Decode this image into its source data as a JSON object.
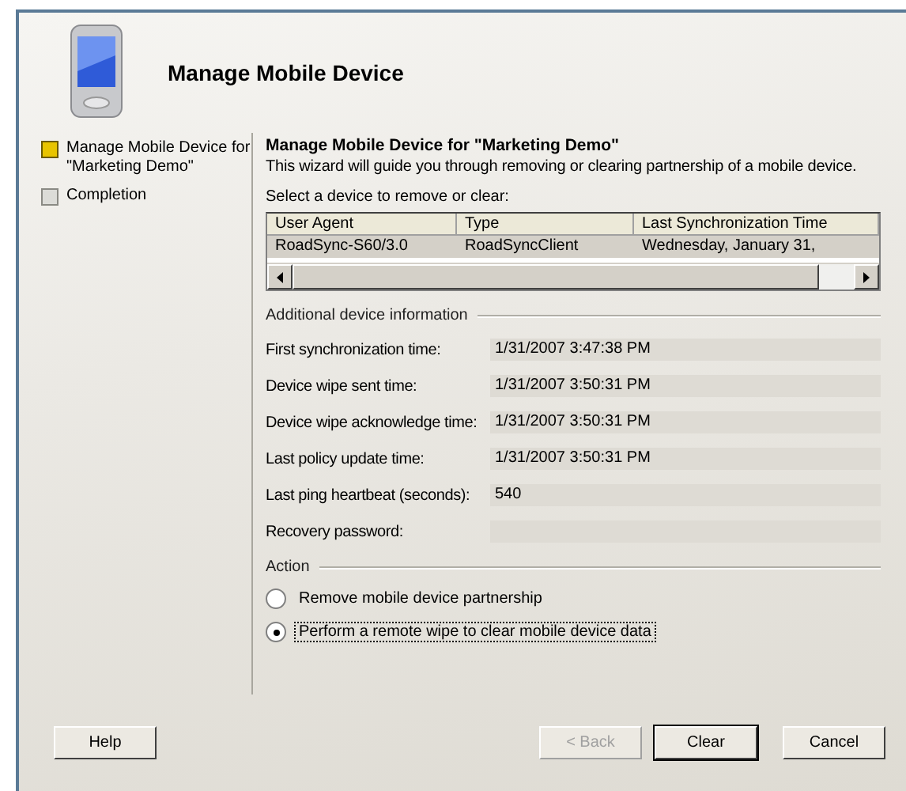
{
  "window": {
    "title": "Manage Mobile Device"
  },
  "steps": [
    {
      "label": "Manage Mobile Device for \"Marketing Demo\"",
      "selected": true
    },
    {
      "label": "Completion",
      "selected": false
    }
  ],
  "content": {
    "heading": "Manage Mobile Device for \"Marketing Demo\"",
    "description": "This wizard will guide you through removing or clearing partnership of a mobile device.",
    "select_label": "Select a device to remove or clear:"
  },
  "table": {
    "columns": [
      "User Agent",
      "Type",
      "Last Synchronization Time"
    ],
    "rows": [
      {
        "cells": [
          "RoadSync-S60/3.0",
          "RoadSyncClient",
          "Wednesday, January 31,"
        ],
        "selected": true
      }
    ]
  },
  "info": {
    "title": "Additional device information",
    "fields": [
      {
        "label": "First synchronization time:",
        "value": "1/31/2007 3:47:38 PM"
      },
      {
        "label": "Device wipe sent time:",
        "value": "1/31/2007 3:50:31 PM"
      },
      {
        "label": "Device wipe acknowledge time:",
        "value": "1/31/2007 3:50:31 PM"
      },
      {
        "label": "Last policy update time:",
        "value": "1/31/2007 3:50:31 PM"
      },
      {
        "label": "Last ping heartbeat (seconds):",
        "value": "540"
      },
      {
        "label": "Recovery password:"
      }
    ]
  },
  "action": {
    "title": "Action",
    "options": [
      {
        "label": "Remove mobile device partnership",
        "selected": false
      },
      {
        "label": "Perform a remote wipe to clear mobile device data",
        "selected": true
      }
    ]
  },
  "buttons": [
    {
      "label": "Help",
      "kind": "help",
      "disabled": false
    },
    {
      "label": "< Back",
      "kind": "nav",
      "disabled": true
    },
    {
      "label": "Clear",
      "kind": "default",
      "disabled": false
    },
    {
      "label": "Cancel",
      "kind": "nav",
      "disabled": false
    }
  ]
}
